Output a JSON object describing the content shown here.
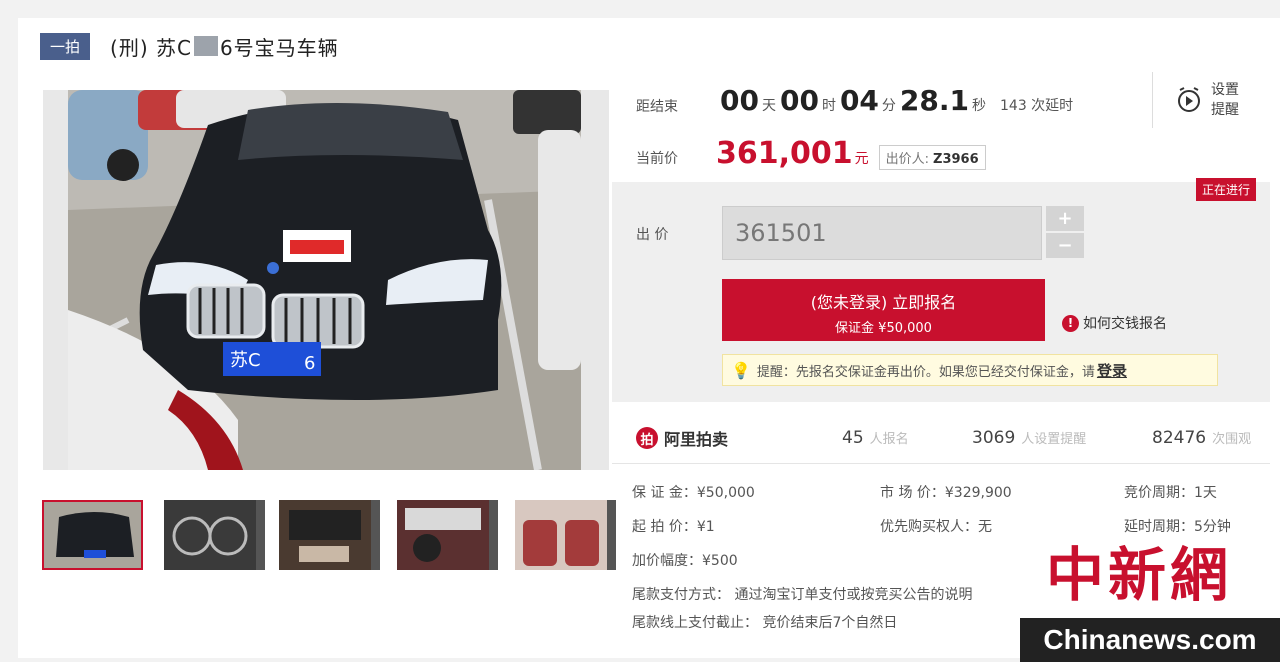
{
  "title": {
    "badge": "一拍",
    "prefix": "(刑) 苏C",
    "suffix": "6号宝马车辆"
  },
  "timer": {
    "label": "距结束",
    "days": "00",
    "days_unit": "天",
    "hours": "00",
    "hours_unit": "时",
    "minutes": "04",
    "minutes_unit": "分",
    "seconds": "28.1",
    "seconds_unit": "秒",
    "extensions": "143 次延时"
  },
  "reminder": {
    "label": "设置提醒",
    "icon": "alarm-clock-icon"
  },
  "current_price": {
    "label": "当前价",
    "value": "361,001",
    "unit": "元",
    "bidder_label": "出价人:",
    "bidder_id": "Z3966"
  },
  "status": "正在进行",
  "bid": {
    "label": "出 价",
    "value": "361501",
    "plus": "+",
    "minus": "−"
  },
  "signup": {
    "line1": "(您未登录) 立即报名",
    "line2": "保证金 ¥50,000"
  },
  "howto": "如何交钱报名",
  "tip": {
    "text": "提醒：先报名交保证金再出价。如果您已经交付保证金，请",
    "link": "登录"
  },
  "platform": {
    "name": "阿里拍卖",
    "icon": "alibaba-auction-icon"
  },
  "stats": [
    {
      "num": "45",
      "label": "人报名"
    },
    {
      "num": "3069",
      "label": "人设置提醒"
    },
    {
      "num": "82476",
      "label": "次围观"
    }
  ],
  "details": {
    "deposit": "保 证 金：¥50,000",
    "market_price": "市 场 价：¥329,900",
    "cycle": "竞价周期：1天",
    "start_price": "起 拍 价：¥1",
    "priority": "优先购买权人：无",
    "delay": "延时周期：5分钟",
    "increment": "加价幅度：¥500",
    "payment_method": "尾款支付方式： 通过淘宝订单支付或按竞买公告的说明",
    "payment_deadline": "尾款线上支付截止： 竞价结束后7个自然日"
  },
  "photo": {
    "plate": "苏C",
    "plate_end": "6"
  },
  "watermark": {
    "cn": "中新網",
    "en": "Chinanews.com"
  },
  "colors": {
    "accent": "#c8102e",
    "badge": "#4a5f8c"
  }
}
